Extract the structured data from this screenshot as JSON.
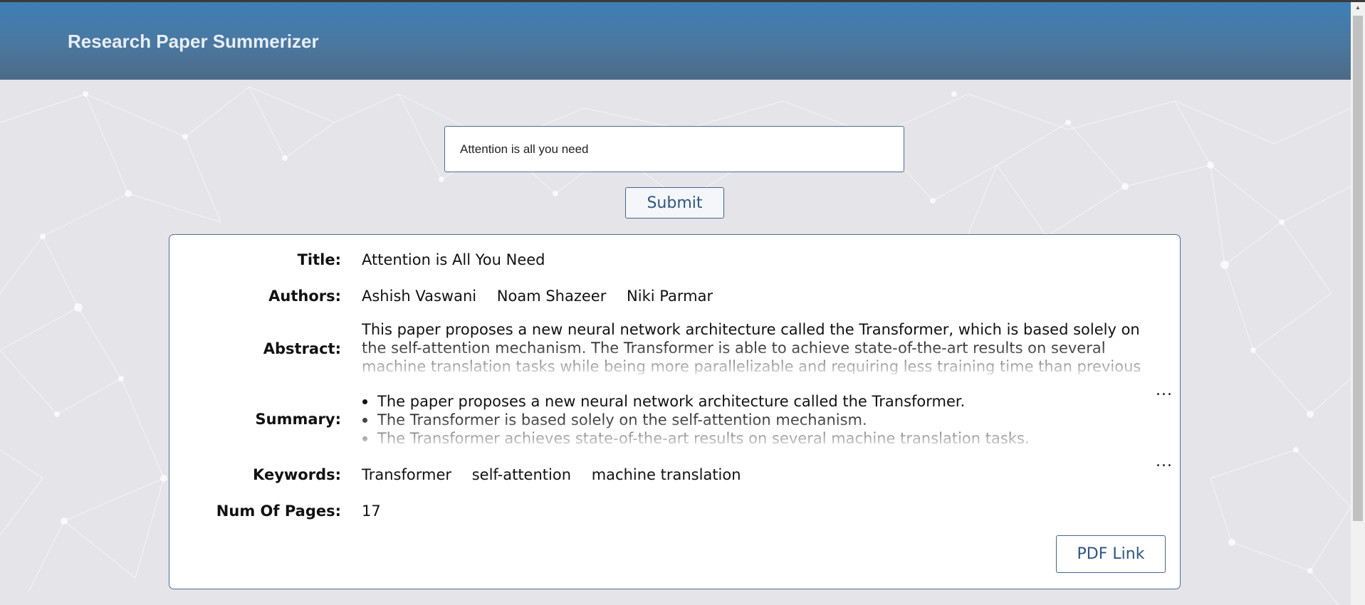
{
  "header": {
    "title": "Research Paper Summerizer"
  },
  "search": {
    "value": "Attention is all you need"
  },
  "submit": {
    "label": "Submit"
  },
  "result": {
    "title_label": "Title:",
    "title_value": "Attention is All You Need",
    "authors_label": "Authors:",
    "authors": [
      "Ashish Vaswani",
      "Noam Shazeer",
      "Niki Parmar"
    ],
    "abstract_label": "Abstract:",
    "abstract_value": "This paper proposes a new neural network architecture called the Transformer, which is based solely on the self-attention mechanism. The Transformer is able to achieve state-of-the-art results on several machine translation tasks while being more parallelizable and requiring less training time than previous models.",
    "summary_label": "Summary:",
    "summary": [
      "The paper proposes a new neural network architecture called the Transformer.",
      "The Transformer is based solely on the self-attention mechanism.",
      "The Transformer achieves state-of-the-art results on several machine translation tasks."
    ],
    "keywords_label": "Keywords:",
    "keywords": [
      "Transformer",
      "self-attention",
      "machine translation"
    ],
    "pages_label": "Num Of Pages:",
    "pages_value": "17",
    "more_icon": "more-horizontal-icon",
    "more_glyph": "...",
    "pdf_label": "PDF Link"
  }
}
